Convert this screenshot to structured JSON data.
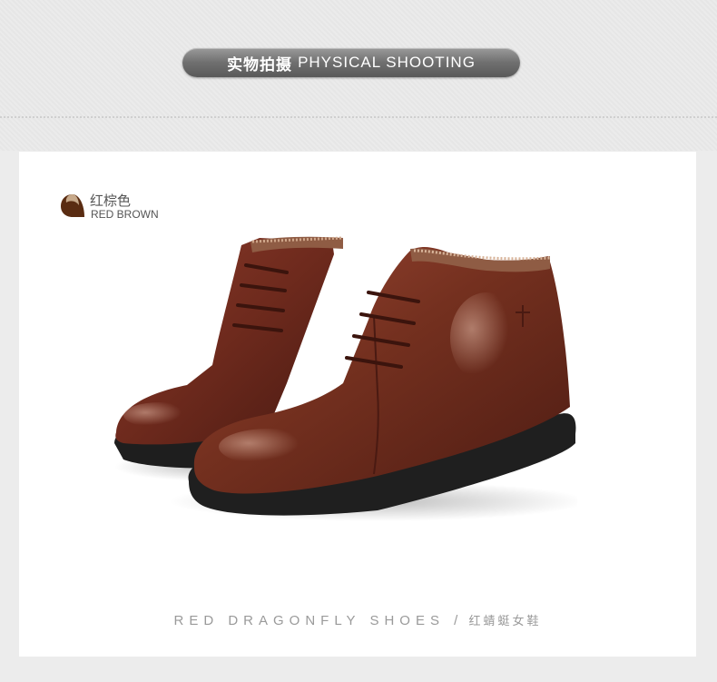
{
  "header": {
    "title_cn": "实物拍摄",
    "title_en": "PHYSICAL SHOOTING"
  },
  "color_tag": {
    "name_cn": "红棕色",
    "name_en": "RED BROWN",
    "swatch_colors": [
      "#c7a98a",
      "#5a2c12"
    ]
  },
  "product": {
    "image_label": "red brown lace-up leather ankle boots"
  },
  "caption": {
    "brand_en": "RED DRAGONFLY SHOES",
    "separator": "/",
    "brand_cn": "红蜻蜓女鞋"
  },
  "colors": {
    "background": "#ececec",
    "panel": "#ffffff",
    "pill": "#6f6f6f",
    "leather": "#6e2a1d",
    "sole": "#1f1f1f"
  }
}
